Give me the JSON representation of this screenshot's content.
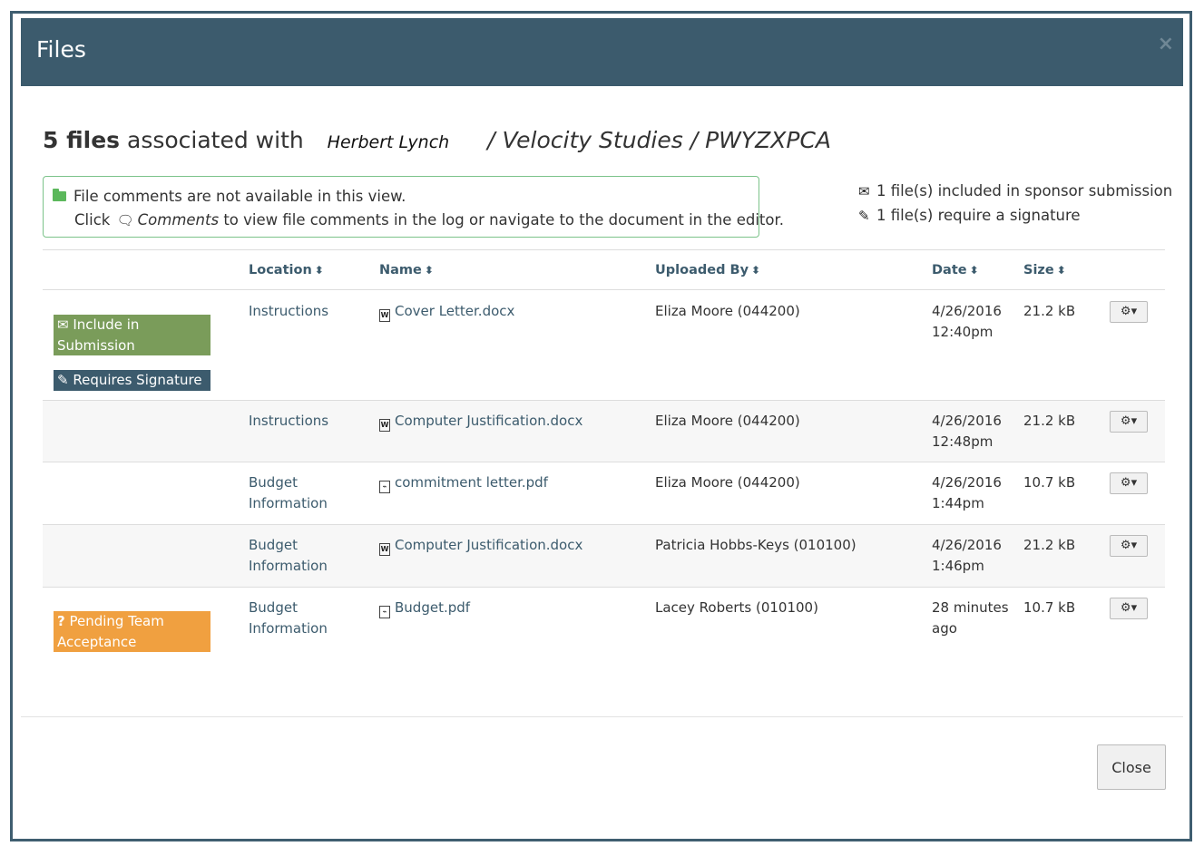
{
  "modal": {
    "title": "Files",
    "close_symbol": "×"
  },
  "heading": {
    "count": "5 files",
    "associated_text": "associated with",
    "person": "Herbert Lynch",
    "path": "/ Velocity Studies / PWYZXPCA"
  },
  "info_box": {
    "line1": "File comments are not available in this view.",
    "line2_prefix": "Click",
    "line2_link": "Comments",
    "line2_suffix": "to view file comments in the log or navigate to the document in the editor."
  },
  "summary": {
    "sponsor": "1 file(s) included in sponsor submission",
    "signature": "1 file(s) require a signature"
  },
  "columns": {
    "location": "Location",
    "name": "Name",
    "uploaded_by": "Uploaded By",
    "date": "Date",
    "size": "Size"
  },
  "rows": [
    {
      "badges": [
        "Include in Submission",
        "Requires Signature"
      ],
      "location": "Instructions",
      "filename": "Cover Letter.docx",
      "file_type": "word",
      "uploaded_by": "Eliza Moore (044200)",
      "date_line1": "4/26/2016",
      "date_line2": "12:40pm",
      "size": "21.2 kB"
    },
    {
      "badges": [],
      "location": "Instructions",
      "filename": "Computer Justification.docx",
      "file_type": "word",
      "uploaded_by": "Eliza Moore (044200)",
      "date_line1": "4/26/2016",
      "date_line2": "12:48pm",
      "size": "21.2 kB"
    },
    {
      "badges": [],
      "location_line1": "Budget",
      "location_line2": "Information",
      "filename": "commitment letter.pdf",
      "file_type": "pdf",
      "uploaded_by": "Eliza Moore (044200)",
      "date_line1": "4/26/2016",
      "date_line2": "1:44pm",
      "size": "10.7 kB"
    },
    {
      "badges": [],
      "location_line1": "Budget",
      "location_line2": "Information",
      "filename": "Computer Justification.docx",
      "file_type": "word",
      "uploaded_by": "Patricia Hobbs-Keys (010100)",
      "date_line1": "4/26/2016",
      "date_line2": "1:46pm",
      "size": "21.2 kB"
    },
    {
      "badges": [
        "Pending Team Acceptance"
      ],
      "location_line1": "Budget",
      "location_line2": "Information",
      "filename": "Budget.pdf",
      "file_type": "pdf",
      "uploaded_by": "Lacey Roberts (010100)",
      "date_line1": "28 minutes",
      "date_line2": "ago",
      "size": "10.7 kB"
    }
  ],
  "badges": {
    "include_line1": "Include in",
    "include_line2": "Submission",
    "signature": "Requires Signature",
    "pending_line1": "Pending Team",
    "pending_line2": "Acceptance"
  },
  "icons": {
    "gear": "⚙",
    "caret": "▾",
    "sort": "⬍",
    "pencil": "✎",
    "envelope": "✉",
    "question": "?",
    "comments": "🗨"
  },
  "colors": {
    "header_bg": "#3c5b6d",
    "include_badge": "#7a9c5a",
    "signature_badge": "#3c5b6d",
    "pending_badge": "#f0a040",
    "info_border": "#7cc38a"
  },
  "footer": {
    "close_label": "Close"
  }
}
